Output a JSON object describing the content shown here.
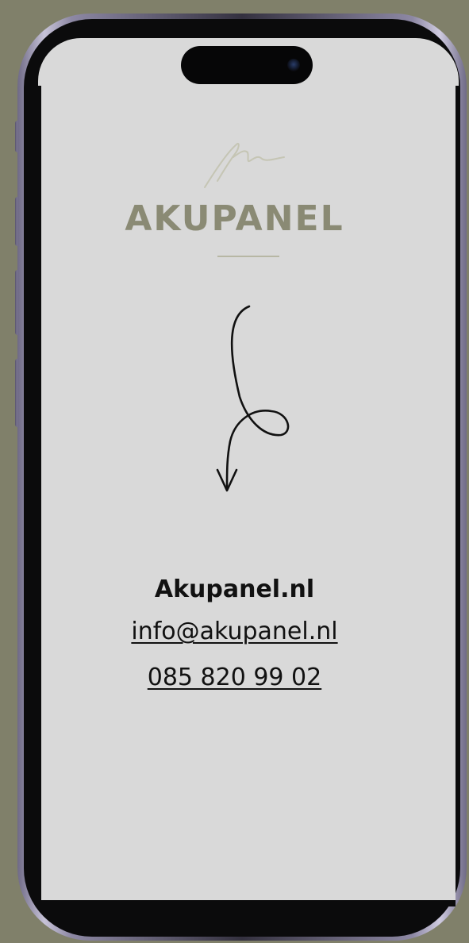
{
  "brand": {
    "name": "AKUPANEL",
    "accent_color": "#8a8a74"
  },
  "contact": {
    "site": "Akupanel.nl",
    "email": "info@akupanel.nl",
    "phone": "085 820 99 02"
  },
  "device": {
    "frame_color": "#7c7796",
    "screen_color": "#d9d9d9",
    "background_color": "#80806a"
  },
  "icons": {
    "signature": "signature-icon",
    "arrow": "curly-arrow-down-icon",
    "camera": "camera-icon"
  }
}
